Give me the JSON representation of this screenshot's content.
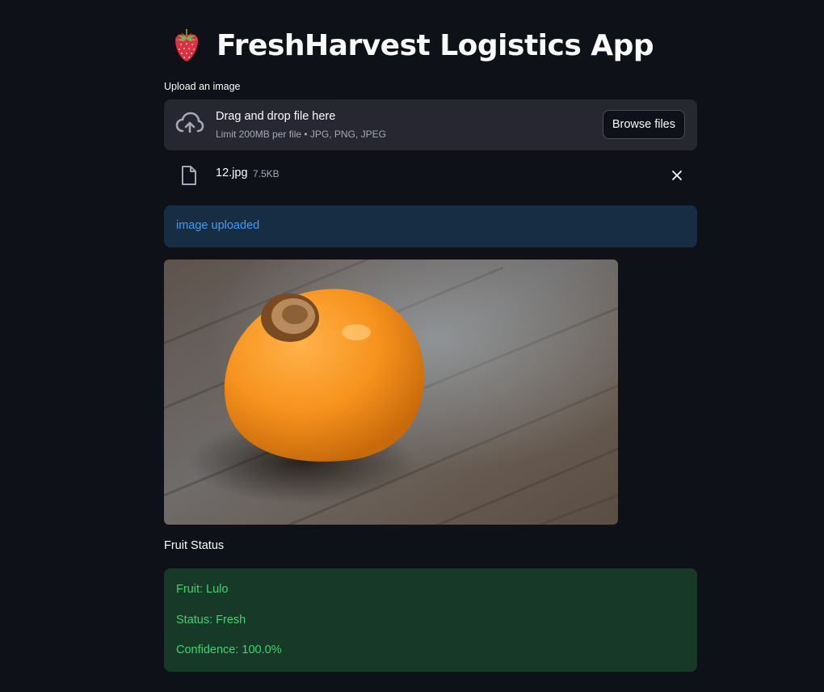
{
  "header": {
    "title": "FreshHarvest Logistics App",
    "emoji_icon": "strawberry-icon"
  },
  "uploader": {
    "label": "Upload an image",
    "dropzone_title": "Drag and drop file here",
    "dropzone_limit": "Limit 200MB per file • JPG, PNG, JPEG",
    "browse_label": "Browse files",
    "upload_icon": "cloud-upload-icon"
  },
  "file": {
    "name": "12.jpg",
    "size": "7.5KB",
    "file_icon": "file-icon",
    "remove_icon": "close-icon"
  },
  "info": {
    "message": "image uploaded"
  },
  "result": {
    "section_label": "Fruit Status",
    "fruit": "Fruit: Lulo",
    "status": "Status: Fresh",
    "confidence": "Confidence: 100.0%"
  },
  "colors": {
    "background": "#0e1117",
    "panel": "#262730",
    "info_bg": "#172d43",
    "info_text": "#3d9df3",
    "success_bg": "#173928",
    "success_text": "#3dd56d"
  }
}
